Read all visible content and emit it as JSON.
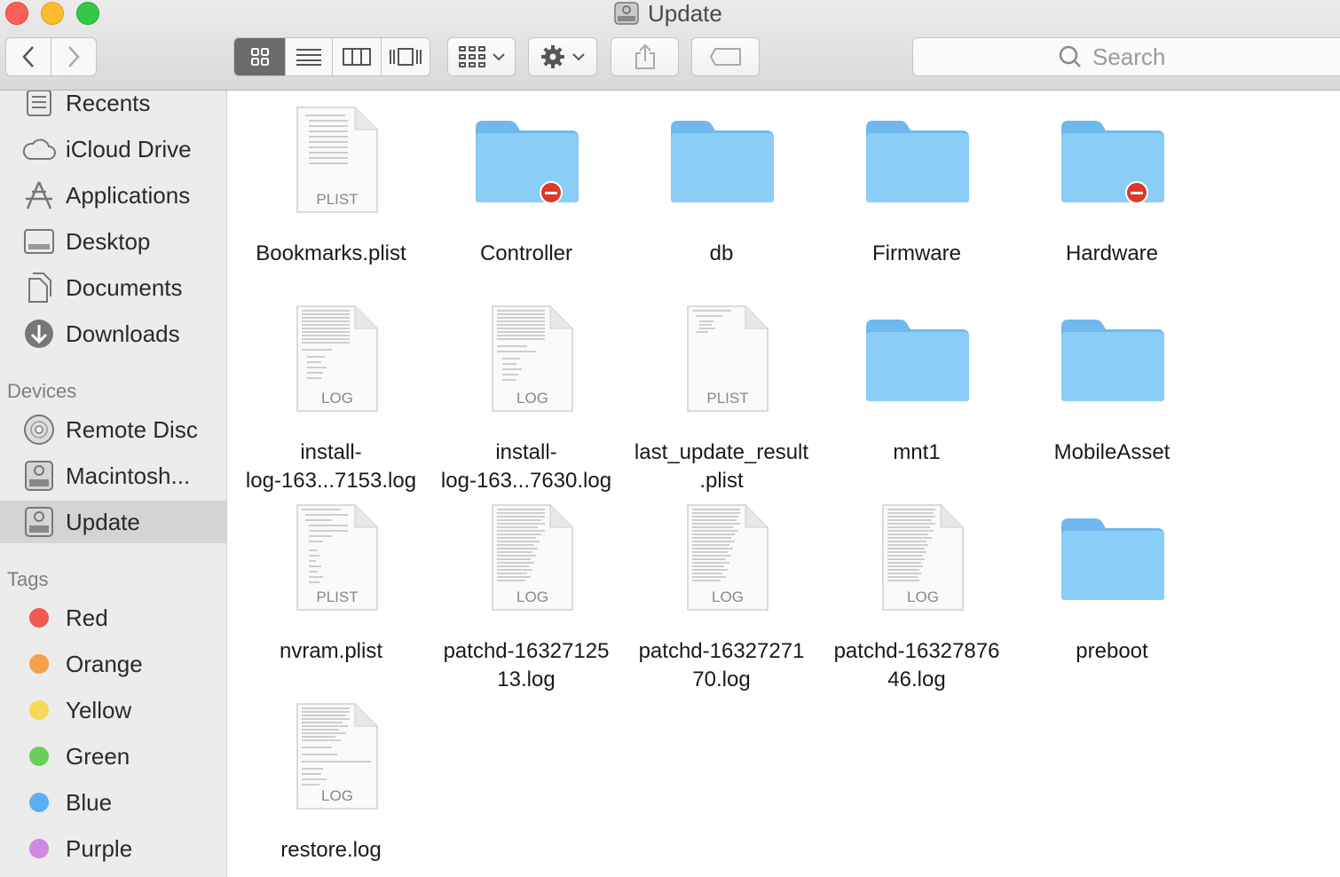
{
  "window": {
    "title": "Update"
  },
  "toolbar": {
    "back": "chevron-left-icon",
    "forward": "chevron-right-icon",
    "views": [
      "icon-view",
      "list-view",
      "column-view",
      "cover-flow-view"
    ],
    "search_placeholder": "Search"
  },
  "sidebar": {
    "favorites": [
      {
        "label": "Recents",
        "icon": "recents-icon"
      },
      {
        "label": "iCloud Drive",
        "icon": "cloud-icon"
      },
      {
        "label": "Applications",
        "icon": "applications-icon"
      },
      {
        "label": "Desktop",
        "icon": "desktop-icon"
      },
      {
        "label": "Documents",
        "icon": "documents-icon"
      },
      {
        "label": "Downloads",
        "icon": "downloads-icon"
      }
    ],
    "devices_header": "Devices",
    "devices": [
      {
        "label": "Remote Disc",
        "icon": "disc-icon"
      },
      {
        "label": "Macintosh...",
        "icon": "drive-icon"
      },
      {
        "label": "Update",
        "icon": "drive-icon",
        "selected": true
      }
    ],
    "tags_header": "Tags",
    "tags": [
      {
        "label": "Red",
        "color": "#f05a4f"
      },
      {
        "label": "Orange",
        "color": "#f5a04a"
      },
      {
        "label": "Yellow",
        "color": "#f8d858"
      },
      {
        "label": "Green",
        "color": "#6cce5b"
      },
      {
        "label": "Blue",
        "color": "#5bb0f5"
      },
      {
        "label": "Purple",
        "color": "#d088e2"
      }
    ]
  },
  "files": [
    {
      "name": "Bookmarks.plist",
      "kind": "doc",
      "ext": "PLIST"
    },
    {
      "name": "Controller",
      "kind": "folder",
      "badge": true
    },
    {
      "name": "db",
      "kind": "folder"
    },
    {
      "name": "Firmware",
      "kind": "folder"
    },
    {
      "name": "Hardware",
      "kind": "folder",
      "badge": true
    },
    {
      "name_line1": "install-",
      "name_line2": "log-163...7153.log",
      "kind": "doc",
      "ext": "LOG"
    },
    {
      "name_line1": "install-",
      "name_line2": "log-163...7630.log",
      "kind": "doc",
      "ext": "LOG"
    },
    {
      "name_line1": "last_update_result",
      "name_line2": ".plist",
      "kind": "doc",
      "ext": "PLIST"
    },
    {
      "name": "mnt1",
      "kind": "folder"
    },
    {
      "name": "MobileAsset",
      "kind": "folder"
    },
    {
      "name": "nvram.plist",
      "kind": "doc",
      "ext": "PLIST"
    },
    {
      "name_line1": "patchd-16327125",
      "name_line2": "13.log",
      "kind": "doc",
      "ext": "LOG"
    },
    {
      "name_line1": "patchd-16327271",
      "name_line2": "70.log",
      "kind": "doc",
      "ext": "LOG"
    },
    {
      "name_line1": "patchd-16327876",
      "name_line2": "46.log",
      "kind": "doc",
      "ext": "LOG"
    },
    {
      "name": "preboot",
      "kind": "folder"
    },
    {
      "name": "restore.log",
      "kind": "doc",
      "ext": "LOG"
    }
  ]
}
